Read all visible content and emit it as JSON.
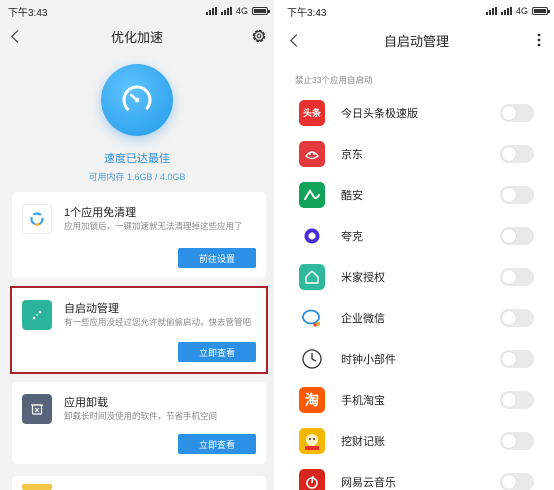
{
  "left_screen": {
    "status": {
      "time": "下午3:43",
      "network": "4G"
    },
    "title": "优化加速",
    "hero": {
      "status_text": "速度已达最佳",
      "memory_text": "可用内存 1.6GB / 4.0GB"
    },
    "cards": [
      {
        "title": "1个应用免清理",
        "desc": "应用加锁后，一键加速就无法清理掉这些应用了",
        "button": "前往设置"
      },
      {
        "title": "自启动管理",
        "desc": "有一些应用没经过您允许就偷偷启动，快去管管吧",
        "button": "立即查看"
      },
      {
        "title": "应用卸载",
        "desc": "卸载长时间没使用的软件，节省手机空间",
        "button": "立即查看"
      }
    ]
  },
  "right_screen": {
    "status": {
      "time": "下午3:43",
      "network": "4G"
    },
    "title": "自启动管理",
    "subtitle": "禁止33个应用自启动",
    "apps": [
      {
        "name": "今日头条极速版",
        "icon_label": "头条",
        "icon_color": "#e8312f"
      },
      {
        "name": "京东",
        "icon_label": "",
        "icon_color": "#e4393c"
      },
      {
        "name": "酷安",
        "icon_label": "",
        "icon_color": "#12a35a"
      },
      {
        "name": "夸克",
        "icon_label": "",
        "icon_color": "#ffffff"
      },
      {
        "name": "米家授权",
        "icon_label": "",
        "icon_color": "#2fb89b"
      },
      {
        "name": "企业微信",
        "icon_label": "",
        "icon_color": "#ffffff"
      },
      {
        "name": "时钟小部件",
        "icon_label": "",
        "icon_color": "#ffffff"
      },
      {
        "name": "手机淘宝",
        "icon_label": "淘",
        "icon_color": "#ff5a00"
      },
      {
        "name": "挖财记账",
        "icon_label": "",
        "icon_color": "#f5b800"
      },
      {
        "name": "网易云音乐",
        "icon_label": "",
        "icon_color": "#d8251d"
      }
    ]
  }
}
